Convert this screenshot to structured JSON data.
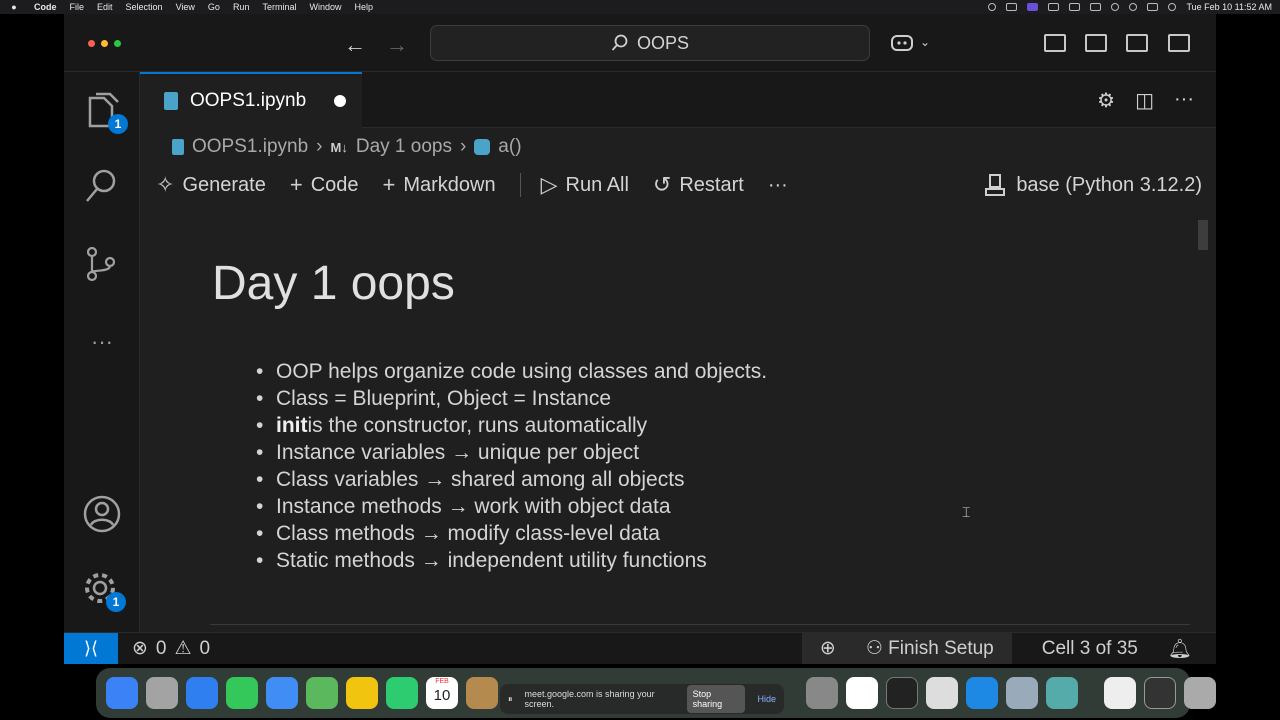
{
  "menubar": {
    "app": "Code",
    "items": [
      "File",
      "Edit",
      "Selection",
      "View",
      "Go",
      "Run",
      "Terminal",
      "Window",
      "Help"
    ],
    "clock": "Tue Feb 10  11:52 AM"
  },
  "titlebar": {
    "search_text": "OOPS"
  },
  "tab": {
    "label": "OOPS1.ipynb"
  },
  "breadcrumb": {
    "file": "OOPS1.ipynb",
    "md_glyph": "M↓",
    "section": "Day 1 oops",
    "symbol": "a()"
  },
  "toolbar": {
    "generate": "Generate",
    "code": "Code",
    "markdown": "Markdown",
    "run_all": "Run All",
    "restart": "Restart",
    "more": "···",
    "kernel": "base (Python 3.12.2)"
  },
  "cell": {
    "heading": "Day 1 oops",
    "bullets": [
      {
        "bold": "",
        "text": "OOP helps organize code using classes and objects."
      },
      {
        "bold": "",
        "text": "Class = Blueprint, Object = Instance"
      },
      {
        "bold": "init",
        "text": " is the constructor, runs automatically"
      },
      {
        "bold": "",
        "text": "Instance variables → unique per object"
      },
      {
        "bold": "",
        "text": "Class variables → shared among all objects"
      },
      {
        "bold": "",
        "text": "Instance methods → work with object data"
      },
      {
        "bold": "",
        "text": "Class methods → modify class-level data"
      },
      {
        "bold": "",
        "text": "Static methods → independent utility functions"
      }
    ]
  },
  "activity": {
    "explorer_badge": "1",
    "settings_badge": "1"
  },
  "statusbar": {
    "errors": "0",
    "warnings": "0",
    "finish_setup": "Finish Setup",
    "cell_position": "Cell 3 of 35"
  },
  "dock": {
    "calendar_month": "FEB",
    "calendar_day": "10",
    "share_text": "meet.google.com is sharing your screen.",
    "stop_sharing": "Stop sharing",
    "hide": "Hide"
  }
}
